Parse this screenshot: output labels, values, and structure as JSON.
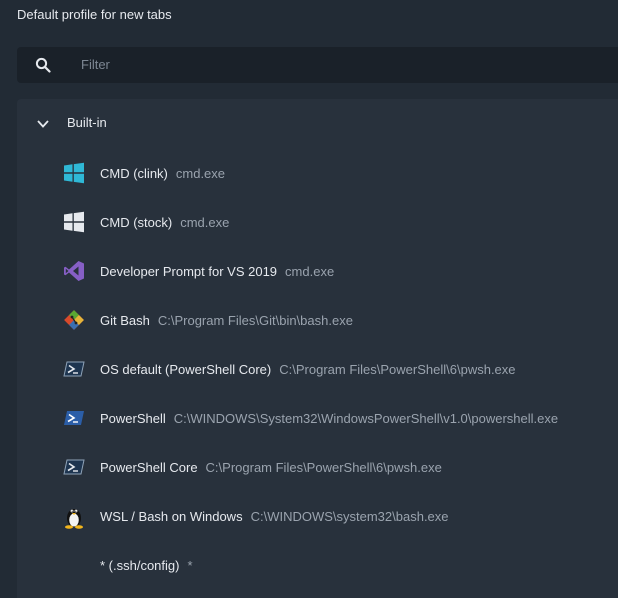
{
  "header": {
    "title": "Default profile for new tabs"
  },
  "search": {
    "placeholder": "Filter",
    "icon": "search-icon"
  },
  "groups": [
    {
      "label": "Built-in",
      "expanded": true,
      "items": [
        {
          "name": "CMD (clink)",
          "command": "cmd.exe",
          "icon": "windows-logo-icon"
        },
        {
          "name": "CMD (stock)",
          "command": "cmd.exe",
          "icon": "windows-logo-icon"
        },
        {
          "name": "Developer Prompt for VS 2019",
          "command": "cmd.exe",
          "icon": "visual-studio-icon"
        },
        {
          "name": "Git Bash",
          "command": "C:\\Program Files\\Git\\bin\\bash.exe",
          "icon": "git-icon"
        },
        {
          "name": "OS default (PowerShell Core)",
          "command": "C:\\Program Files\\PowerShell\\6\\pwsh.exe",
          "icon": "powershell-icon"
        },
        {
          "name": "PowerShell",
          "command": "C:\\WINDOWS\\System32\\WindowsPowerShell\\v1.0\\powershell.exe",
          "icon": "powershell-icon"
        },
        {
          "name": "PowerShell Core",
          "command": "C:\\Program Files\\PowerShell\\6\\pwsh.exe",
          "icon": "powershell-icon"
        },
        {
          "name": "WSL / Bash on Windows",
          "command": "C:\\WINDOWS\\system32\\bash.exe",
          "icon": "linux-tux-icon"
        },
        {
          "name": "* (.ssh/config)",
          "command": "*",
          "icon": ""
        }
      ]
    }
  ],
  "colors": {
    "background": "#222b35",
    "panel": "#28313c",
    "search_bg": "#1a2129",
    "text": "#e6e9ee",
    "muted": "#9aa3ae",
    "windows_cyan": "#2fb8d6",
    "vs_purple": "#865fc5",
    "powershell_blue": "#2b5ea8"
  }
}
